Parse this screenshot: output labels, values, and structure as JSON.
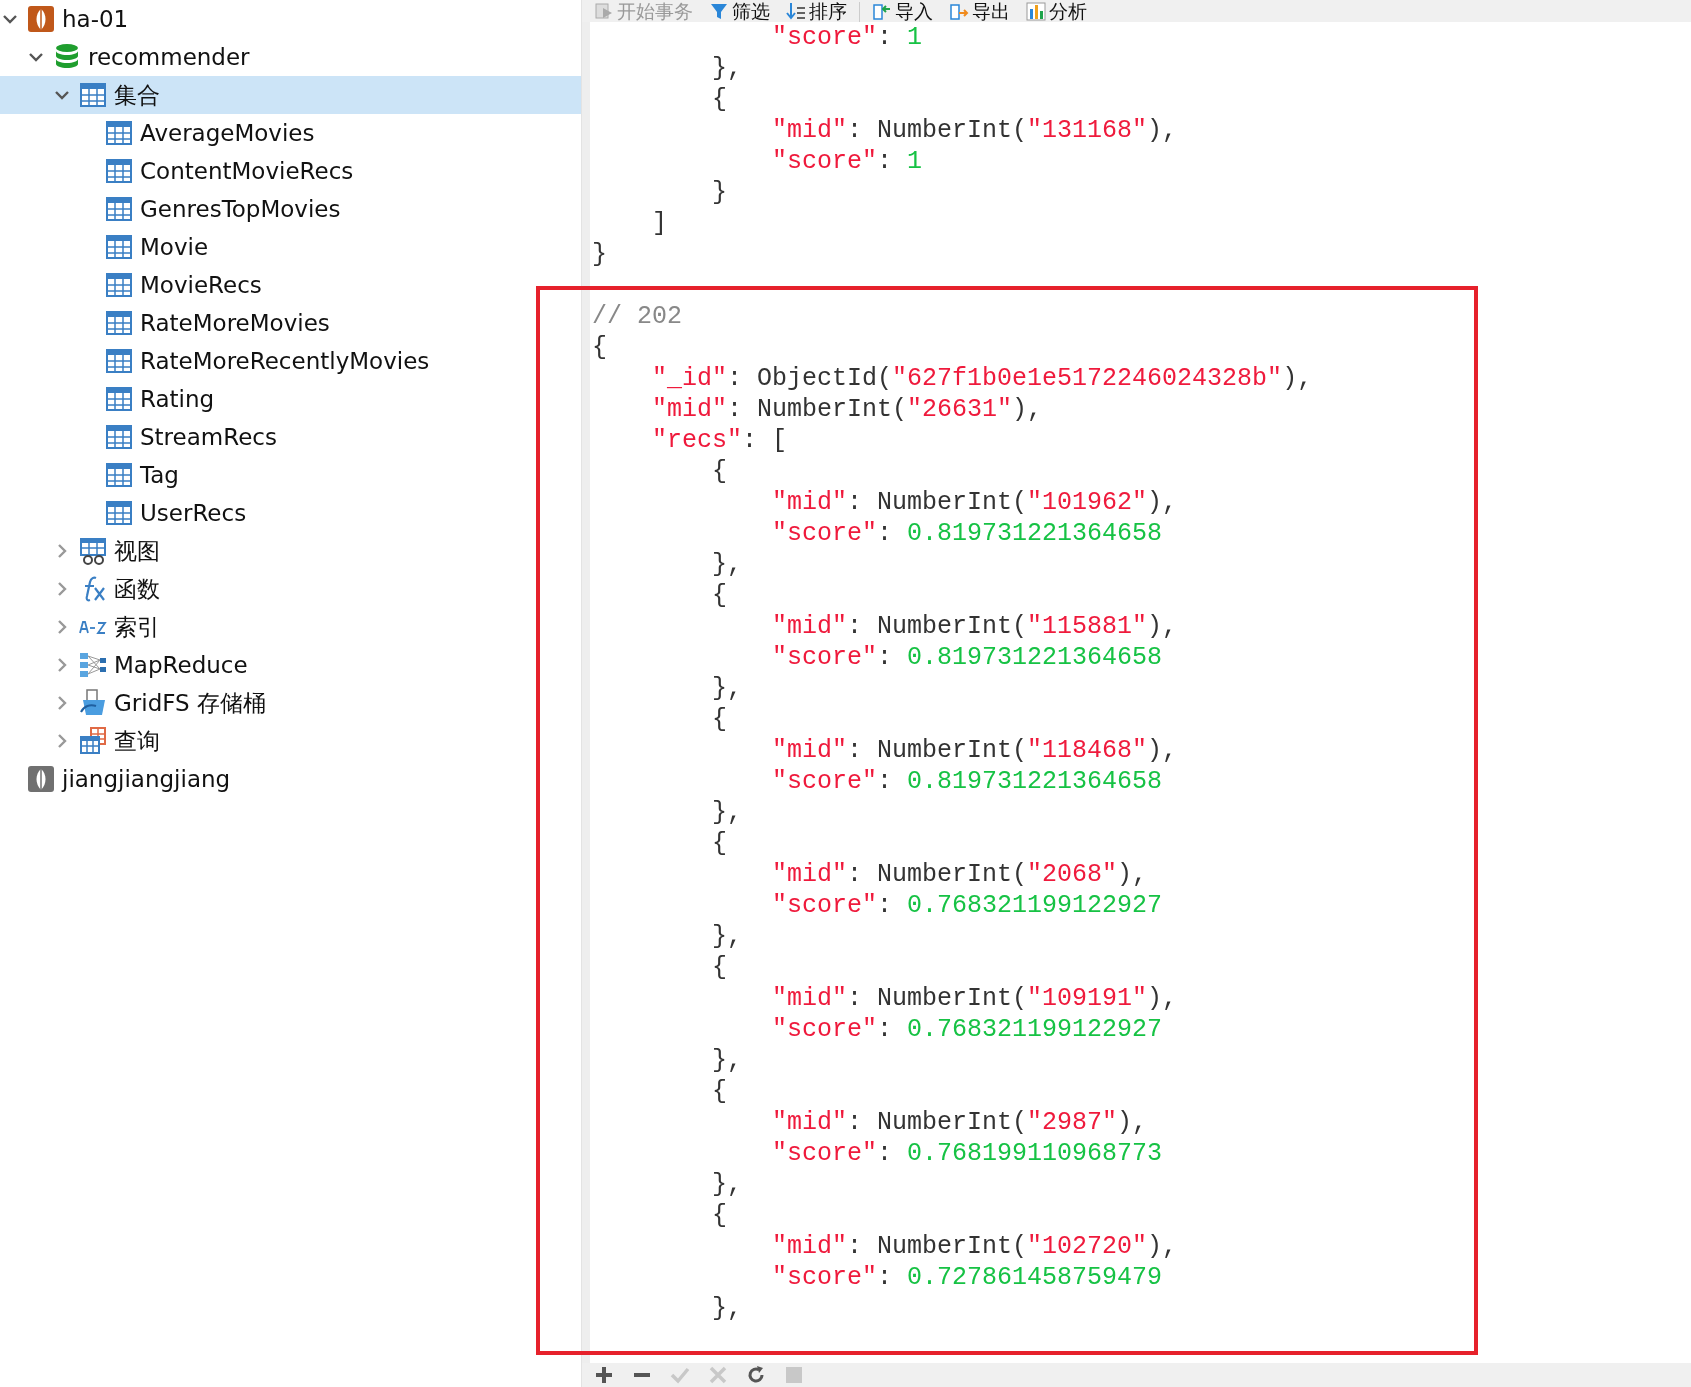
{
  "sidebar": {
    "items": [
      {
        "kind": "connection",
        "label": "ha-01",
        "expanded": true,
        "selected": false,
        "children": [
          {
            "kind": "database",
            "label": "recommender",
            "expanded": true,
            "selected": false,
            "children": [
              {
                "kind": "collections",
                "label": "集合",
                "expanded": true,
                "selected": true,
                "children": [
                  {
                    "kind": "collection",
                    "label": "AverageMovies",
                    "selected": false
                  },
                  {
                    "kind": "collection",
                    "label": "ContentMovieRecs",
                    "selected": false
                  },
                  {
                    "kind": "collection",
                    "label": "GenresTopMovies",
                    "selected": false
                  },
                  {
                    "kind": "collection",
                    "label": "Movie",
                    "selected": false
                  },
                  {
                    "kind": "collection",
                    "label": "MovieRecs",
                    "selected": false
                  },
                  {
                    "kind": "collection",
                    "label": "RateMoreMovies",
                    "selected": false
                  },
                  {
                    "kind": "collection",
                    "label": "RateMoreRecentlyMovies",
                    "selected": false
                  },
                  {
                    "kind": "collection",
                    "label": "Rating",
                    "selected": false
                  },
                  {
                    "kind": "collection",
                    "label": "StreamRecs",
                    "selected": false
                  },
                  {
                    "kind": "collection",
                    "label": "Tag",
                    "selected": false
                  },
                  {
                    "kind": "collection",
                    "label": "UserRecs",
                    "selected": false
                  }
                ]
              },
              {
                "kind": "views",
                "label": "视图",
                "expanded": false,
                "selected": false
              },
              {
                "kind": "functions",
                "label": "函数",
                "expanded": false,
                "selected": false
              },
              {
                "kind": "indexes",
                "label": "索引",
                "expanded": false,
                "selected": false
              },
              {
                "kind": "mapreduce",
                "label": "MapReduce",
                "expanded": false,
                "selected": false
              },
              {
                "kind": "gridfs",
                "label": "GridFS 存储桶",
                "expanded": false,
                "selected": false
              },
              {
                "kind": "queries",
                "label": "查询",
                "expanded": false,
                "selected": false
              }
            ]
          }
        ]
      },
      {
        "kind": "connection-offline",
        "label": "jiangjiangjiang",
        "selected": false
      }
    ]
  },
  "toolbar": [
    {
      "kind": "transaction",
      "label": "开始事务",
      "disabled": true
    },
    {
      "kind": "filter",
      "label": "筛选",
      "disabled": false
    },
    {
      "kind": "sort",
      "label": "排序",
      "disabled": false
    },
    {
      "kind": "separator"
    },
    {
      "kind": "import",
      "label": "导入",
      "disabled": false
    },
    {
      "kind": "export",
      "label": "导出",
      "disabled": false
    },
    {
      "kind": "analyze",
      "label": "分析",
      "disabled": false
    }
  ],
  "code_lines": [
    {
      "children": [
        {
          "children": [
            {
              "children": [
                {
                  "tokens": [
                    {
                      "kind": "key",
                      "text": "\"score\""
                    },
                    {
                      "kind": "plain",
                      "text": ": "
                    },
                    {
                      "kind": "number",
                      "text": "1"
                    }
                  ]
                }
              ]
            },
            {
              "tokens": [
                {
                  "kind": "plain",
                  "text": "},"
                }
              ]
            },
            {
              "tokens": [
                {
                  "kind": "plain",
                  "text": "{"
                }
              ],
              "children": [
                {
                  "tokens": [
                    {
                      "kind": "key",
                      "text": "\"mid\""
                    },
                    {
                      "kind": "plain",
                      "text": ": NumberInt("
                    },
                    {
                      "kind": "string",
                      "text": "\"131168\""
                    },
                    {
                      "kind": "plain",
                      "text": "),"
                    }
                  ]
                },
                {
                  "tokens": [
                    {
                      "kind": "key",
                      "text": "\"score\""
                    },
                    {
                      "kind": "plain",
                      "text": ": "
                    },
                    {
                      "kind": "number",
                      "text": "1"
                    }
                  ]
                }
              ]
            },
            {
              "tokens": [
                {
                  "kind": "plain",
                  "text": "}"
                }
              ]
            }
          ]
        },
        {
          "tokens": [
            {
              "kind": "plain",
              "text": "]"
            }
          ]
        }
      ]
    },
    {
      "tokens": [
        {
          "kind": "plain",
          "text": "}"
        }
      ]
    },
    {
      "tokens": [
        {
          "kind": "comment",
          "text": "// 202"
        }
      ]
    },
    {
      "tokens": [
        {
          "kind": "plain",
          "text": "{"
        }
      ],
      "children": [
        {
          "tokens": [
            {
              "kind": "key",
              "text": "\"_id\""
            },
            {
              "kind": "plain",
              "text": ": ObjectId("
            },
            {
              "kind": "string",
              "text": "\"627f1b0e1e5172246024328b\""
            },
            {
              "kind": "plain",
              "text": "),"
            }
          ]
        },
        {
          "tokens": [
            {
              "kind": "key",
              "text": "\"mid\""
            },
            {
              "kind": "plain",
              "text": ": NumberInt("
            },
            {
              "kind": "string",
              "text": "\"26631\""
            },
            {
              "kind": "plain",
              "text": "),"
            }
          ]
        },
        {
          "tokens": [
            {
              "kind": "key",
              "text": "\"recs\""
            },
            {
              "kind": "plain",
              "text": ": ["
            }
          ],
          "children": [
            {
              "tokens": [
                {
                  "kind": "plain",
                  "text": "{"
                }
              ],
              "children": [
                {
                  "tokens": [
                    {
                      "kind": "key",
                      "text": "\"mid\""
                    },
                    {
                      "kind": "plain",
                      "text": ": NumberInt("
                    },
                    {
                      "kind": "string",
                      "text": "\"101962\""
                    },
                    {
                      "kind": "plain",
                      "text": "),"
                    }
                  ]
                },
                {
                  "tokens": [
                    {
                      "kind": "key",
                      "text": "\"score\""
                    },
                    {
                      "kind": "plain",
                      "text": ": "
                    },
                    {
                      "kind": "number",
                      "text": "0.819731221364658"
                    }
                  ]
                }
              ]
            },
            {
              "tokens": [
                {
                  "kind": "plain",
                  "text": "},"
                }
              ]
            },
            {
              "tokens": [
                {
                  "kind": "plain",
                  "text": "{"
                }
              ],
              "children": [
                {
                  "tokens": [
                    {
                      "kind": "key",
                      "text": "\"mid\""
                    },
                    {
                      "kind": "plain",
                      "text": ": NumberInt("
                    },
                    {
                      "kind": "string",
                      "text": "\"115881\""
                    },
                    {
                      "kind": "plain",
                      "text": "),"
                    }
                  ]
                },
                {
                  "tokens": [
                    {
                      "kind": "key",
                      "text": "\"score\""
                    },
                    {
                      "kind": "plain",
                      "text": ": "
                    },
                    {
                      "kind": "number",
                      "text": "0.819731221364658"
                    }
                  ]
                }
              ]
            },
            {
              "tokens": [
                {
                  "kind": "plain",
                  "text": "},"
                }
              ]
            },
            {
              "tokens": [
                {
                  "kind": "plain",
                  "text": "{"
                }
              ],
              "children": [
                {
                  "tokens": [
                    {
                      "kind": "key",
                      "text": "\"mid\""
                    },
                    {
                      "kind": "plain",
                      "text": ": NumberInt("
                    },
                    {
                      "kind": "string",
                      "text": "\"118468\""
                    },
                    {
                      "kind": "plain",
                      "text": "),"
                    }
                  ]
                },
                {
                  "tokens": [
                    {
                      "kind": "key",
                      "text": "\"score\""
                    },
                    {
                      "kind": "plain",
                      "text": ": "
                    },
                    {
                      "kind": "number",
                      "text": "0.819731221364658"
                    }
                  ]
                }
              ]
            },
            {
              "tokens": [
                {
                  "kind": "plain",
                  "text": "},"
                }
              ]
            },
            {
              "tokens": [
                {
                  "kind": "plain",
                  "text": "{"
                }
              ],
              "children": [
                {
                  "tokens": [
                    {
                      "kind": "key",
                      "text": "\"mid\""
                    },
                    {
                      "kind": "plain",
                      "text": ": NumberInt("
                    },
                    {
                      "kind": "string",
                      "text": "\"2068\""
                    },
                    {
                      "kind": "plain",
                      "text": "),"
                    }
                  ]
                },
                {
                  "tokens": [
                    {
                      "kind": "key",
                      "text": "\"score\""
                    },
                    {
                      "kind": "plain",
                      "text": ": "
                    },
                    {
                      "kind": "number",
                      "text": "0.768321199122927"
                    }
                  ]
                }
              ]
            },
            {
              "tokens": [
                {
                  "kind": "plain",
                  "text": "},"
                }
              ]
            },
            {
              "tokens": [
                {
                  "kind": "plain",
                  "text": "{"
                }
              ],
              "children": [
                {
                  "tokens": [
                    {
                      "kind": "key",
                      "text": "\"mid\""
                    },
                    {
                      "kind": "plain",
                      "text": ": NumberInt("
                    },
                    {
                      "kind": "string",
                      "text": "\"109191\""
                    },
                    {
                      "kind": "plain",
                      "text": "),"
                    }
                  ]
                },
                {
                  "tokens": [
                    {
                      "kind": "key",
                      "text": "\"score\""
                    },
                    {
                      "kind": "plain",
                      "text": ": "
                    },
                    {
                      "kind": "number",
                      "text": "0.768321199122927"
                    }
                  ]
                }
              ]
            },
            {
              "tokens": [
                {
                  "kind": "plain",
                  "text": "},"
                }
              ]
            },
            {
              "tokens": [
                {
                  "kind": "plain",
                  "text": "{"
                }
              ],
              "children": [
                {
                  "tokens": [
                    {
                      "kind": "key",
                      "text": "\"mid\""
                    },
                    {
                      "kind": "plain",
                      "text": ": NumberInt("
                    },
                    {
                      "kind": "string",
                      "text": "\"2987\""
                    },
                    {
                      "kind": "plain",
                      "text": "),"
                    }
                  ]
                },
                {
                  "tokens": [
                    {
                      "kind": "key",
                      "text": "\"score\""
                    },
                    {
                      "kind": "plain",
                      "text": ": "
                    },
                    {
                      "kind": "number",
                      "text": "0.768199110968773"
                    }
                  ]
                }
              ]
            },
            {
              "tokens": [
                {
                  "kind": "plain",
                  "text": "},"
                }
              ]
            },
            {
              "tokens": [
                {
                  "kind": "plain",
                  "text": "{"
                }
              ],
              "children": [
                {
                  "tokens": [
                    {
                      "kind": "key",
                      "text": "\"mid\""
                    },
                    {
                      "kind": "plain",
                      "text": ": NumberInt("
                    },
                    {
                      "kind": "string",
                      "text": "\"102720\""
                    },
                    {
                      "kind": "plain",
                      "text": "),"
                    }
                  ]
                },
                {
                  "tokens": [
                    {
                      "kind": "key",
                      "text": "\"score\""
                    },
                    {
                      "kind": "plain",
                      "text": ": "
                    },
                    {
                      "kind": "number",
                      "text": "0.727861458759479"
                    }
                  ]
                }
              ]
            },
            {
              "tokens": [
                {
                  "kind": "plain",
                  "text": "},"
                }
              ]
            }
          ]
        }
      ]
    }
  ],
  "bottom_toolbar": [
    {
      "kind": "add",
      "disabled": false
    },
    {
      "kind": "remove",
      "disabled": false
    },
    {
      "kind": "apply",
      "disabled": true
    },
    {
      "kind": "discard",
      "disabled": true
    },
    {
      "kind": "refresh",
      "disabled": false
    },
    {
      "kind": "stop",
      "disabled": true
    }
  ],
  "annotation": {
    "kind": "frame"
  }
}
